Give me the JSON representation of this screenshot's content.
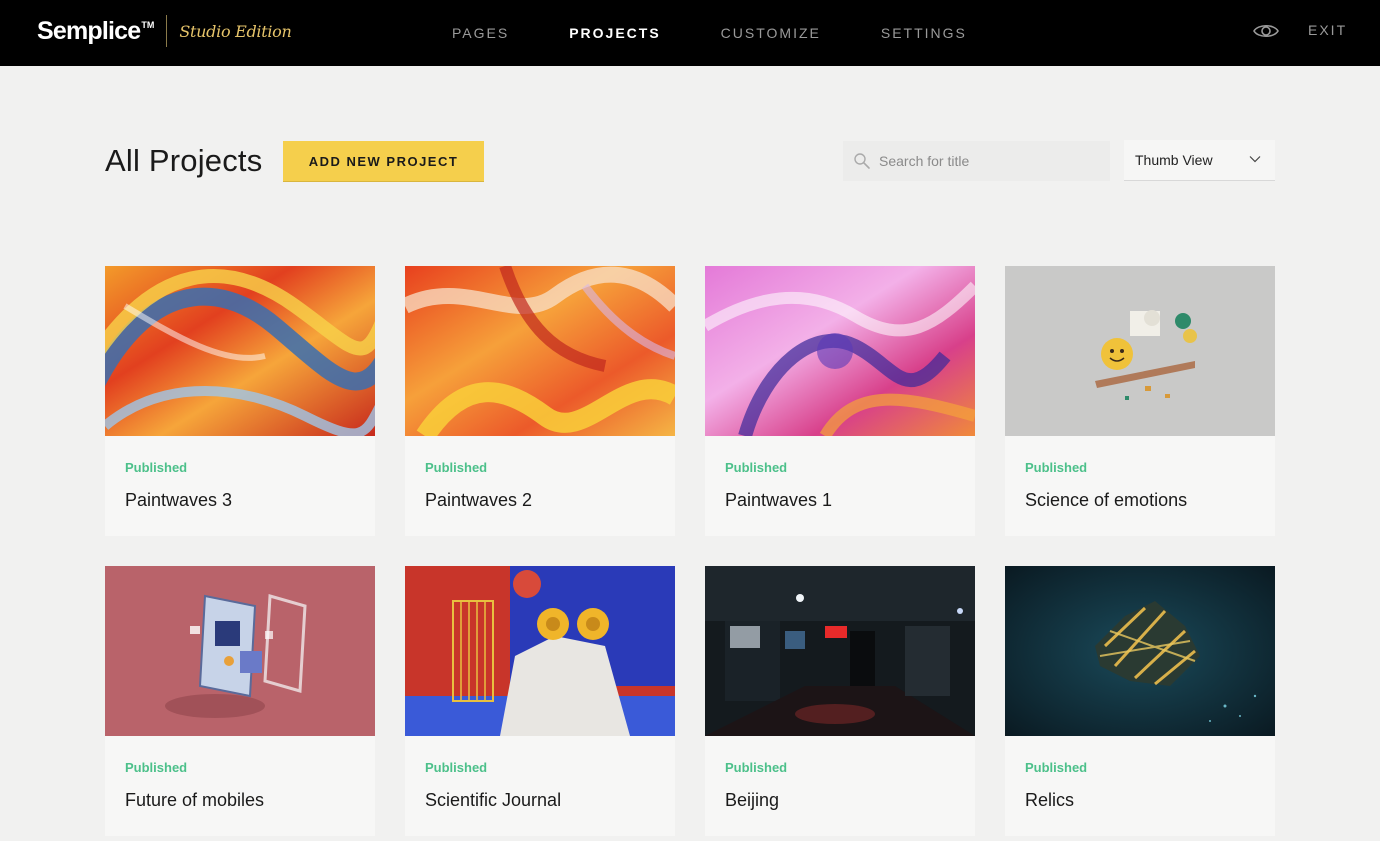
{
  "brand": {
    "name": "Semplice",
    "tm": "TM",
    "edition": "Studio Edition"
  },
  "nav": {
    "items": [
      {
        "label": "PAGES",
        "active": false
      },
      {
        "label": "PROJECTS",
        "active": true
      },
      {
        "label": "CUSTOMIZE",
        "active": false
      },
      {
        "label": "SETTINGS",
        "active": false
      }
    ],
    "preview_icon": "eye-icon",
    "exit_label": "EXIT"
  },
  "toolbar": {
    "title": "All Projects",
    "add_label": "ADD NEW PROJECT",
    "search_placeholder": "Search for title",
    "search_value": "",
    "view_selected": "Thumb View"
  },
  "colors": {
    "accent": "#f5cf4c",
    "published": "#4cc08a",
    "topbar": "#000000",
    "background": "#f1f1f0"
  },
  "projects": [
    {
      "status": "Published",
      "title": "Paintwaves 3"
    },
    {
      "status": "Published",
      "title": "Paintwaves 2"
    },
    {
      "status": "Published",
      "title": "Paintwaves 1"
    },
    {
      "status": "Published",
      "title": "Science of emotions"
    },
    {
      "status": "Published",
      "title": "Future of mobiles"
    },
    {
      "status": "Published",
      "title": "Scientific Journal"
    },
    {
      "status": "Published",
      "title": "Beijing"
    },
    {
      "status": "Published",
      "title": "Relics"
    }
  ]
}
